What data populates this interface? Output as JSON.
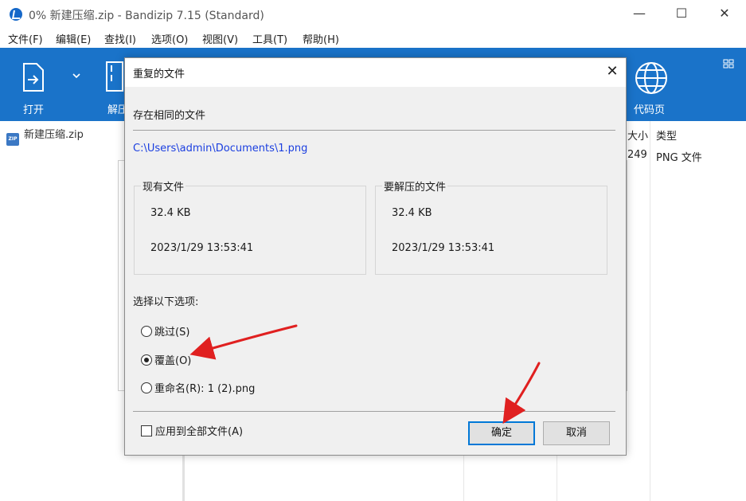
{
  "window": {
    "title": "0% 新建压缩.zip - Bandizip 7.15 (Standard)",
    "min_glyph": "—",
    "max_glyph": "☐",
    "close_glyph": "✕"
  },
  "menu": [
    "文件(F)",
    "编辑(E)",
    "查找(I)",
    "选项(O)",
    "视图(V)",
    "工具(T)",
    "帮助(H)"
  ],
  "toolbar": {
    "open_label": "打开",
    "extract_label_partial": "解压",
    "code_page_label": "代码页"
  },
  "tree": {
    "archive_name": "新建压缩.zip",
    "zip_icon_text": "ZIP"
  },
  "list": {
    "col_size_partial": "大小",
    "col_type": "类型",
    "row_size_partial": "249",
    "row_type": "PNG 文件"
  },
  "dialog": {
    "title": "重复的文件",
    "heading": "存在相同的文件",
    "path": "C:\\Users\\admin\\Documents\\1.png",
    "existing": {
      "title": "现有文件",
      "size": "32.4 KB",
      "date": "2023/1/29 13:53:41"
    },
    "incoming": {
      "title": "要解压的文件",
      "size": "32.4 KB",
      "date": "2023/1/29 13:53:41"
    },
    "choose_label": "选择以下选项:",
    "options": [
      {
        "label": "跳过(S)",
        "checked": false
      },
      {
        "label": "覆盖(O)",
        "checked": true
      },
      {
        "label": "重命名(R): 1 (2).png",
        "checked": false
      }
    ],
    "apply_all_label": "应用到全部文件(A)",
    "ok_label": "确定",
    "cancel_label": "取消"
  },
  "colors": {
    "toolbar_bg": "#1a73c9",
    "path_text": "#1b3fe0",
    "arrow": "#e02020",
    "ok_border": "#0078d7"
  }
}
